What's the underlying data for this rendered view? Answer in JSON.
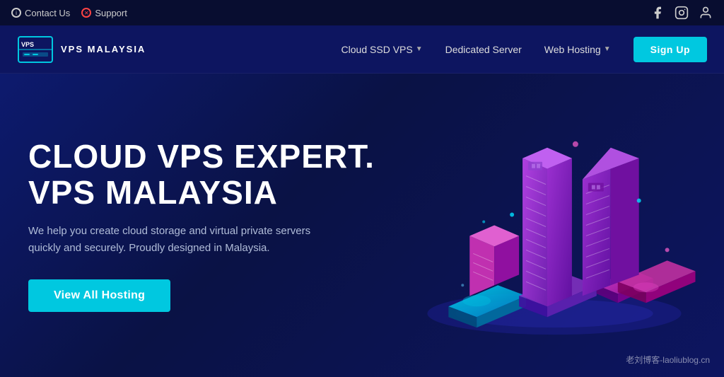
{
  "topbar": {
    "contact_label": "Contact Us",
    "support_label": "Support"
  },
  "navbar": {
    "logo_brand": "VPS MALAYSIA",
    "logo_registered": "®",
    "nav_items": [
      {
        "label": "Cloud SSD VPS",
        "has_dropdown": true
      },
      {
        "label": "Dedicated Server",
        "has_dropdown": false
      },
      {
        "label": "Web Hosting",
        "has_dropdown": true
      }
    ],
    "signup_label": "Sign Up"
  },
  "hero": {
    "title_line1": "CLOUD VPS EXPERT.",
    "title_line2": "VPS MALAYSIA",
    "description": "We help you create cloud storage and virtual private servers quickly and securely. Proudly designed in Malaysia.",
    "cta_label": "View All Hosting"
  },
  "watermark": {
    "text": "老刘博客-laoliublog.cn"
  },
  "colors": {
    "accent_cyan": "#00c8e0",
    "bg_dark": "#0a1045",
    "bg_nav": "#0d1560",
    "bg_topbar": "#080d30",
    "server_purple": "#8b3fc8",
    "server_magenta": "#c040a0"
  }
}
